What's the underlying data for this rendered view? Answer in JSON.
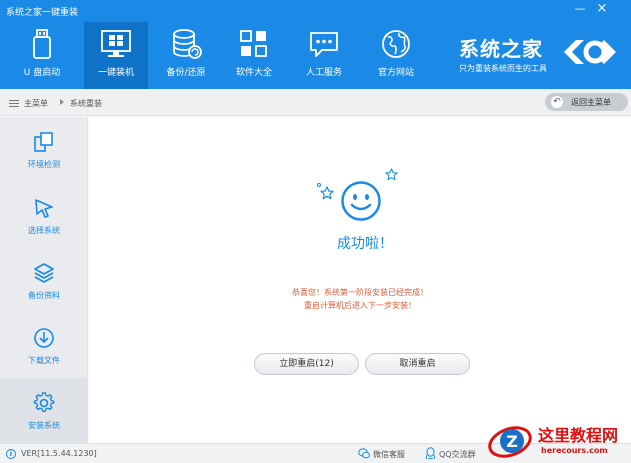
{
  "window": {
    "title": "系统之家一键重装",
    "minimize_glyph": "—",
    "close_glyph": "×"
  },
  "nav": {
    "items": [
      {
        "label": "U 盘启动",
        "icon": "usb-drive-icon"
      },
      {
        "label": "一键装机",
        "icon": "windows-desktop-icon",
        "active": true
      },
      {
        "label": "备份/还原",
        "icon": "database-backup-icon"
      },
      {
        "label": "软件大全",
        "icon": "app-grid-icon"
      },
      {
        "label": "人工服务",
        "icon": "chat-bubble-icon"
      },
      {
        "label": "官方网站",
        "icon": "globe-icon"
      }
    ]
  },
  "brand": {
    "name": "系统之家",
    "slogan": "只为重装系统而生的工具"
  },
  "breadcrumb": {
    "items": [
      "主菜单",
      "系统重装"
    ],
    "back_label": "返回主菜单"
  },
  "sidebar": {
    "items": [
      {
        "label": "环境检测",
        "icon": "environment-check-icon"
      },
      {
        "label": "选择系统",
        "icon": "cursor-select-icon"
      },
      {
        "label": "备份资料",
        "icon": "layers-backup-icon"
      },
      {
        "label": "下载文件",
        "icon": "download-icon"
      },
      {
        "label": "安装系统",
        "icon": "gear-icon",
        "active": true
      }
    ]
  },
  "main": {
    "title": "成功啦！",
    "message_line1": "恭喜您！系统第一阶段安装已经完成！",
    "message_line2": "重启计算机后进入下一步安装！",
    "restart_button": "立即重启(12)",
    "cancel_button": "取消重启"
  },
  "status": {
    "version": "VER[11.5.44.1230]",
    "wechat_label": "微信客服",
    "qq_label": "QQ交流群"
  },
  "watermark": {
    "title": "这里教程网",
    "url": "herecours.com"
  },
  "colors": {
    "accent": "#1a8ae6",
    "message": "#e05b3a",
    "watermark": "#e01010"
  }
}
